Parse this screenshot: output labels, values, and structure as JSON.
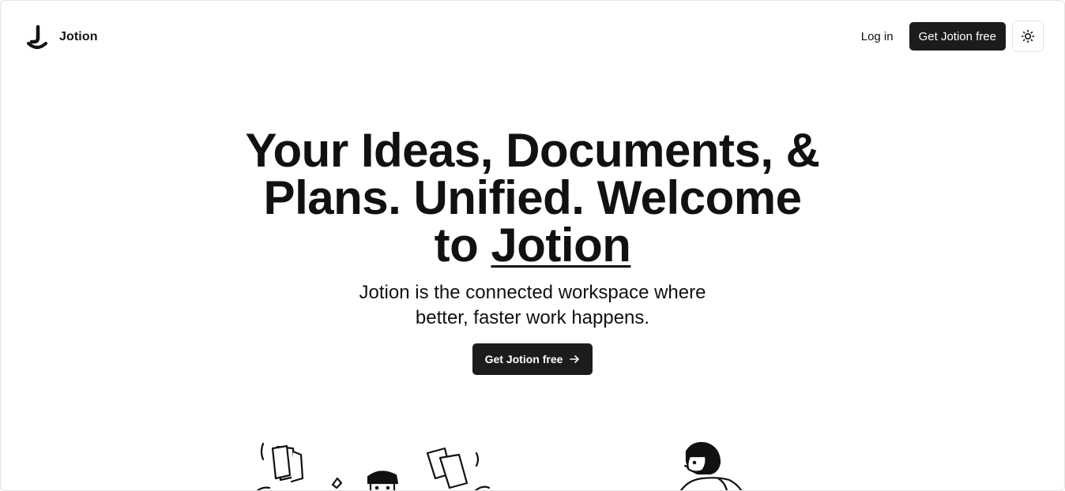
{
  "navbar": {
    "brand_name": "Jotion",
    "login_label": "Log in",
    "cta_label": "Get Jotion free",
    "theme_icon": "sun-icon"
  },
  "hero": {
    "title_part1": "Your Ideas, Documents, &",
    "title_part2": "Plans. Unified. Welcome",
    "title_part3": "to",
    "title_brand": "Jotion",
    "subtitle_line1": "Jotion is the connected workspace where",
    "subtitle_line2": "better, faster work happens.",
    "cta_label": "Get Jotion free",
    "cta_icon": "arrow-right-icon"
  },
  "illustrations": {
    "left": "documents-illustration",
    "right": "reading-illustration"
  },
  "colors": {
    "primary": "#1c1c1c",
    "background": "#ffffff",
    "text": "#111111"
  }
}
